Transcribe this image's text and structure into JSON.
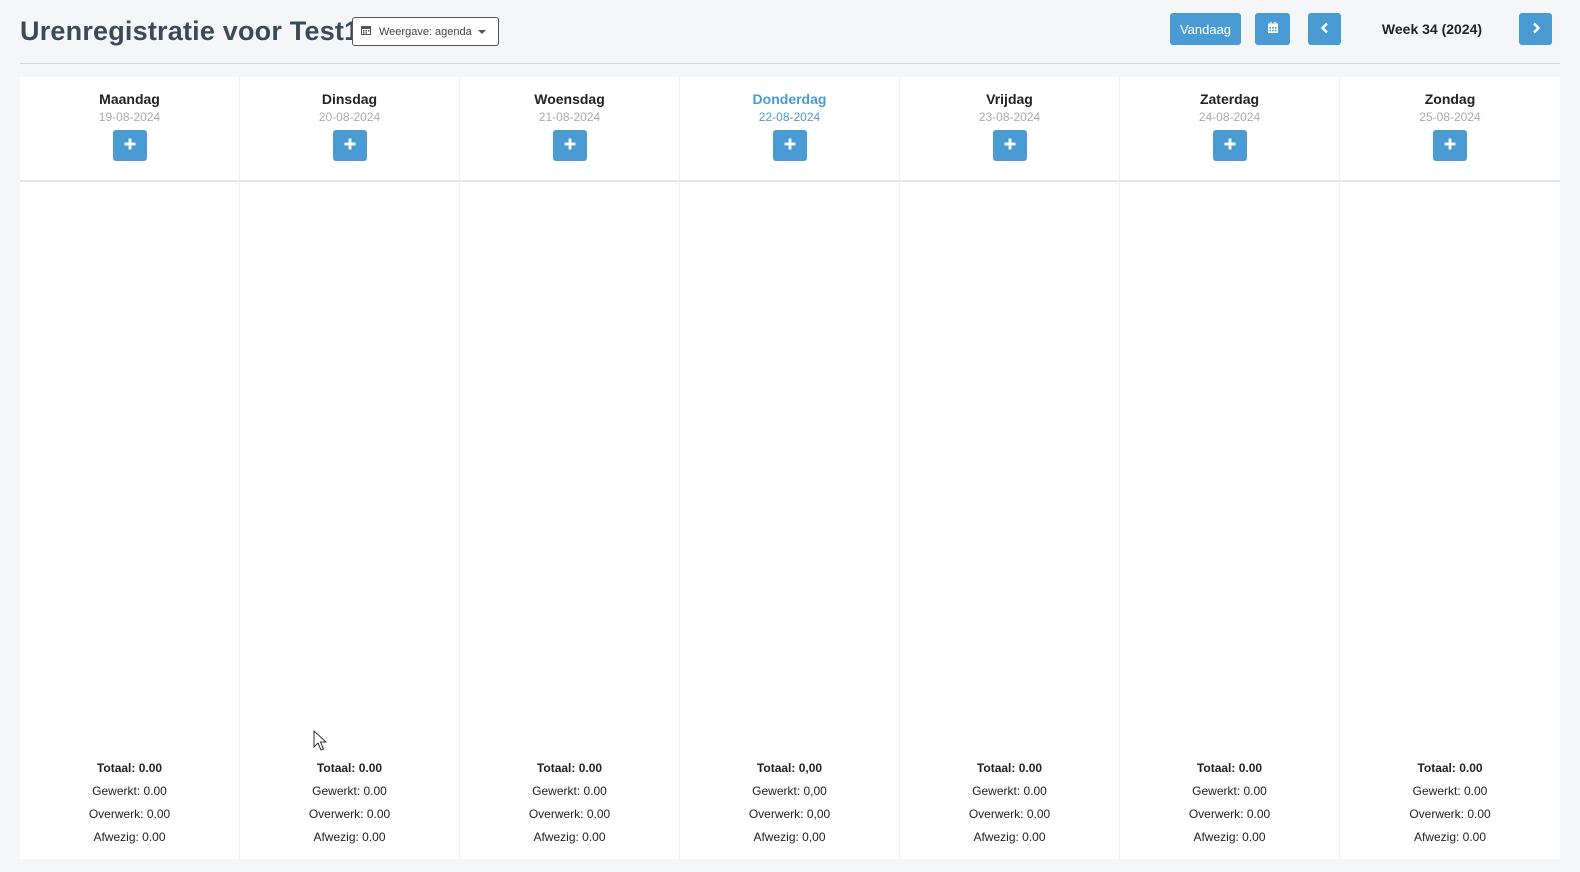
{
  "header": {
    "title": "Urenregistratie voor Test1",
    "view_dropdown_label": "Weergave: agenda",
    "today_button": "Vandaag",
    "week_label": "Week 34 (2024)",
    "icons": {
      "calendar": "calendar-icon",
      "prev": "chevron-left-icon",
      "next": "chevron-right-icon",
      "add": "plus-icon"
    },
    "accent_color": "#4a9ad4"
  },
  "days": [
    {
      "name": "Maandag",
      "date": "19-08-2024",
      "totaal": "Totaal: 0.00",
      "gewerkt": "Gewerkt: 0.00",
      "overwerk": "Overwerk: 0.00",
      "afwezig": "Afwezig: 0.00"
    },
    {
      "name": "Dinsdag",
      "date": "20-08-2024",
      "totaal": "Totaal: 0.00",
      "gewerkt": "Gewerkt: 0.00",
      "overwerk": "Overwerk: 0.00",
      "afwezig": "Afwezig: 0.00"
    },
    {
      "name": "Woensdag",
      "date": "21-08-2024",
      "totaal": "Totaal: 0.00",
      "gewerkt": "Gewerkt: 0.00",
      "overwerk": "Overwerk: 0.00",
      "afwezig": "Afwezig: 0.00"
    },
    {
      "name": "Donderdag",
      "date": "22-08-2024",
      "totaal": "Totaal: 0,00",
      "gewerkt": "Gewerkt: 0,00",
      "overwerk": "Overwerk: 0,00",
      "afwezig": "Afwezig: 0,00"
    },
    {
      "name": "Vrijdag",
      "date": "23-08-2024",
      "totaal": "Totaal: 0.00",
      "gewerkt": "Gewerkt: 0.00",
      "overwerk": "Overwerk: 0.00",
      "afwezig": "Afwezig: 0.00"
    },
    {
      "name": "Zaterdag",
      "date": "24-08-2024",
      "totaal": "Totaal: 0.00",
      "gewerkt": "Gewerkt: 0.00",
      "overwerk": "Overwerk: 0.00",
      "afwezig": "Afwezig: 0.00"
    },
    {
      "name": "Zondag",
      "date": "25-08-2024",
      "totaal": "Totaal: 0.00",
      "gewerkt": "Gewerkt: 0.00",
      "overwerk": "Overwerk: 0.00",
      "afwezig": "Afwezig: 0.00"
    }
  ]
}
